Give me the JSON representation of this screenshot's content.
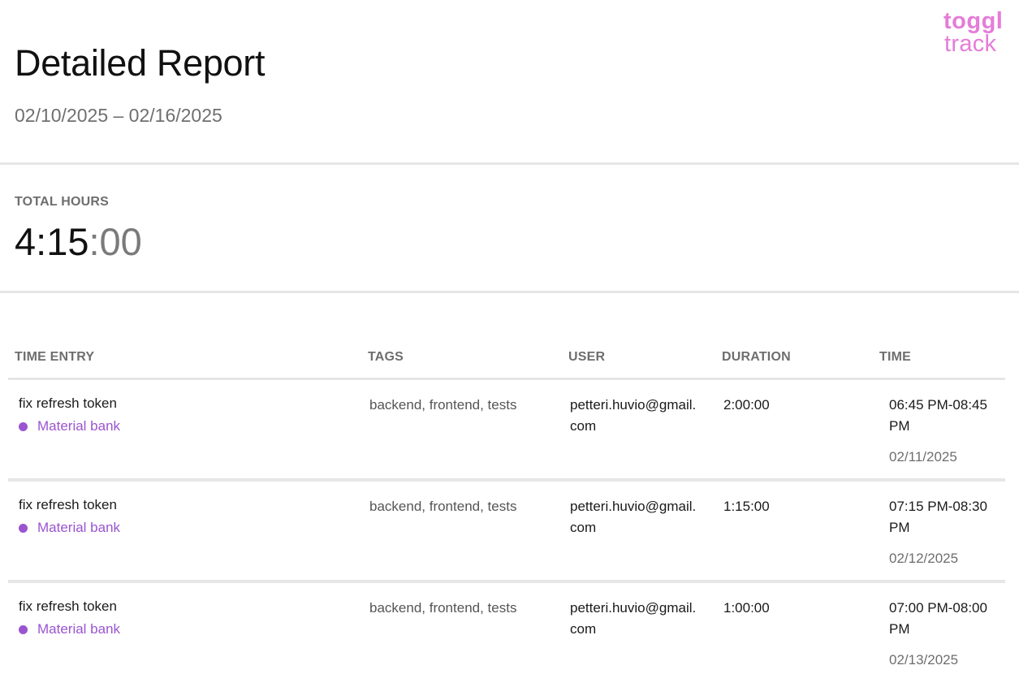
{
  "header": {
    "title": "Detailed Report",
    "date_range": "02/10/2025 – 02/16/2025",
    "logo": {
      "line1": "toggl",
      "line2": "track",
      "color": "#e57cd8"
    }
  },
  "summary": {
    "label": "TOTAL HOURS",
    "hours_minutes": "4:15",
    "seconds": ":00"
  },
  "table": {
    "columns": [
      "TIME ENTRY",
      "TAGS",
      "USER",
      "DURATION",
      "TIME"
    ],
    "rows": [
      {
        "description": "fix refresh token",
        "project": "Material bank",
        "project_color": "#9a54d0",
        "tags": "backend, frontend, tests",
        "user": "petteri.huvio@gmail.com",
        "duration": "2:00:00",
        "time_range": "06:45 PM-08:45 PM",
        "date": "02/11/2025"
      },
      {
        "description": "fix refresh token",
        "project": "Material bank",
        "project_color": "#9a54d0",
        "tags": "backend, frontend, tests",
        "user": "petteri.huvio@gmail.com",
        "duration": "1:15:00",
        "time_range": "07:15 PM-08:30 PM",
        "date": "02/12/2025"
      },
      {
        "description": "fix refresh token",
        "project": "Material bank",
        "project_color": "#9a54d0",
        "tags": "backend, frontend, tests",
        "user": "petteri.huvio@gmail.com",
        "duration": "1:00:00",
        "time_range": "07:00 PM-08:00 PM",
        "date": "02/13/2025"
      }
    ]
  }
}
